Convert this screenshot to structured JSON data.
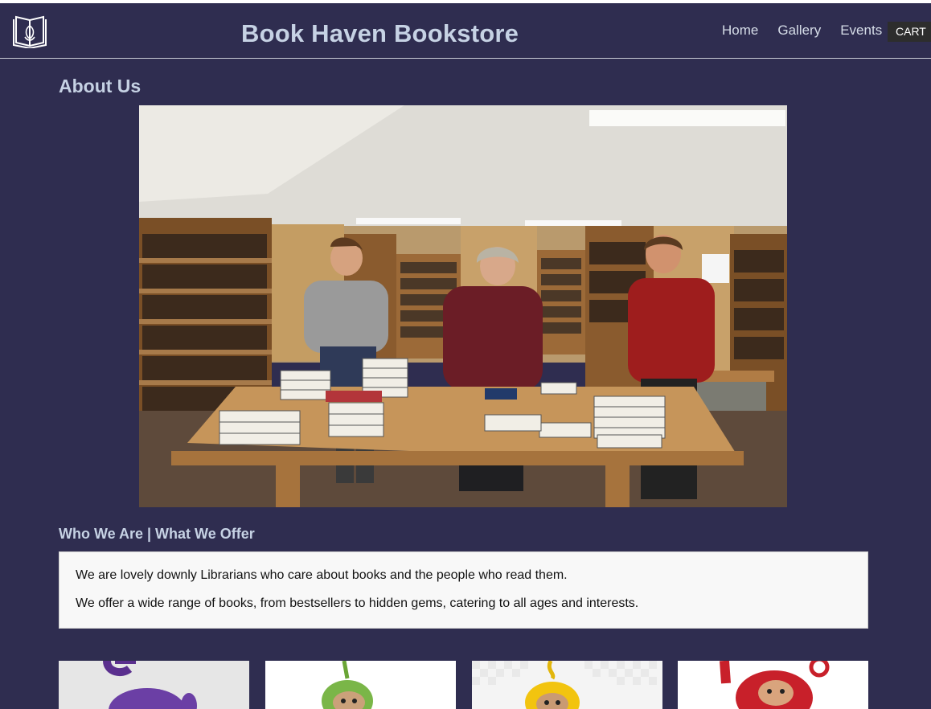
{
  "header": {
    "title": "Book Haven Bookstore",
    "logo_icon": "open-book-logo-icon",
    "nav": [
      {
        "label": "Home"
      },
      {
        "label": "Gallery"
      },
      {
        "label": "Events"
      }
    ],
    "cart_label": "CART"
  },
  "about": {
    "heading": "About Us",
    "photo_alt": "Librarians arranging books on a library table"
  },
  "offer": {
    "heading": "Who We Are | What We Offer",
    "paragraphs": [
      "We are lovely downly Librarians who care about books and the people who read them.",
      "We offer a wide range of books, from bestsellers to hidden gems, catering to all ages and interests."
    ]
  },
  "gallery": {
    "cards": [
      {
        "name": "purple-character",
        "color": "#6a3fa0",
        "bg": "#e6e6e6"
      },
      {
        "name": "green-character",
        "color": "#7ab648",
        "bg": "#ffffff"
      },
      {
        "name": "yellow-character",
        "color": "#f2c40f",
        "bg": "#f4f4f4"
      },
      {
        "name": "red-character",
        "color": "#c8202a",
        "bg": "#ffffff"
      }
    ]
  },
  "colors": {
    "page_bg": "#2f2d50",
    "heading_text": "#c6d2e4",
    "cart_bg": "#2d2d2d"
  }
}
